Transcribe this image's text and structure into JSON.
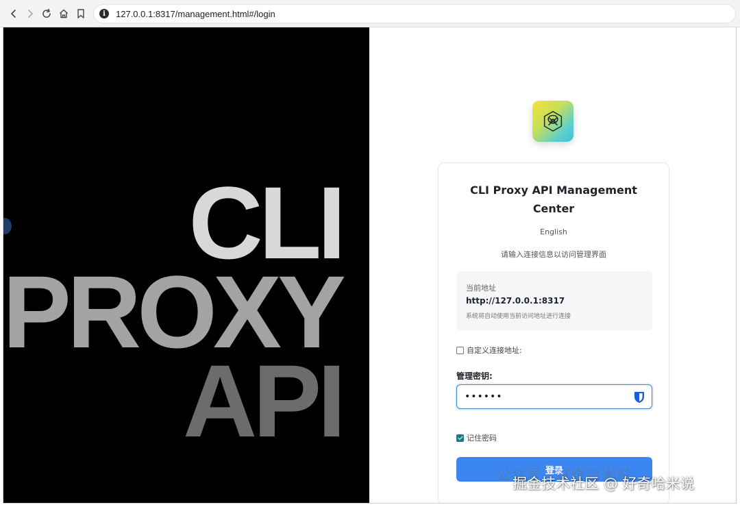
{
  "browser": {
    "url": "127.0.0.1:8317/management.html#/login",
    "info_icon": "i"
  },
  "hero": {
    "line1": "CLI",
    "line2": "PROXY",
    "line3": "API"
  },
  "login": {
    "title": "CLI Proxy API Management Center",
    "language_toggle": "English",
    "subtitle": "请输入连接信息以访问管理界面",
    "current_address_label": "当前地址",
    "current_address_value": "http://127.0.0.1:8317",
    "current_address_hint": "系统将自动使用当前访问地址进行连接",
    "custom_address_label": "自定义连接地址:",
    "custom_address_checked": false,
    "management_key_label": "管理密钥:",
    "management_key_value": "••••••",
    "remember_password_label": "记住密码",
    "remember_password_checked": true,
    "login_button": "登录"
  },
  "watermark": {
    "faint": "公众号 · 好奇哈米说",
    "main": "掘金技术社区 @ 好奇哈米说"
  },
  "colors": {
    "primary_button": "#3b86f0",
    "input_focus_border": "#3f84c7",
    "checkbox_checked": "#1f7a78",
    "hero_background": "#000000"
  },
  "icons": {
    "back": "arrow-left-icon",
    "forward": "arrow-right-icon",
    "reload": "reload-icon",
    "home": "home-icon",
    "bookmark": "bookmark-icon",
    "site_info": "info-icon",
    "logo": "app-logo-icon",
    "password_manager": "shield-icon"
  }
}
